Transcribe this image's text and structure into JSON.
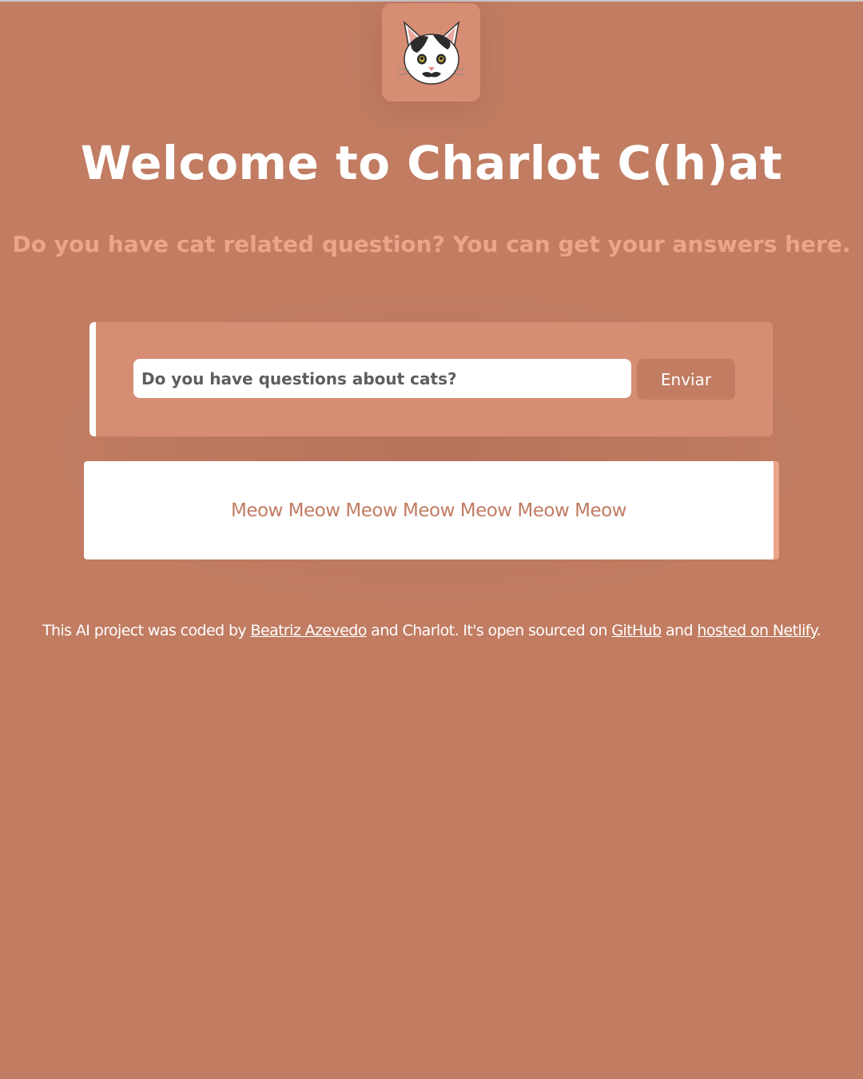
{
  "logo": {
    "icon": "cat-face-icon",
    "background": "#d68d73"
  },
  "header": {
    "title": "Welcome to Charlot C(h)at",
    "subtitle": "Do you have cat related question? You can get your answers here."
  },
  "form": {
    "input_placeholder": "Do you have questions about cats?",
    "input_value": "",
    "submit_label": "Enviar"
  },
  "answer": {
    "text": "Meow Meow Meow Meow Meow Meow Meow"
  },
  "footer": {
    "part1": "This AI project was coded by ",
    "author_link": "Beatriz Azevedo",
    "part2": " and Charlot. It's open sourced on ",
    "github_link": "GitHub",
    "part3": " and ",
    "netlify_link": "hosted on Netlify",
    "part4": "."
  },
  "colors": {
    "background": "#c17c62",
    "card": "#d68d73",
    "accent": "#eaa58a",
    "white": "#ffffff"
  }
}
